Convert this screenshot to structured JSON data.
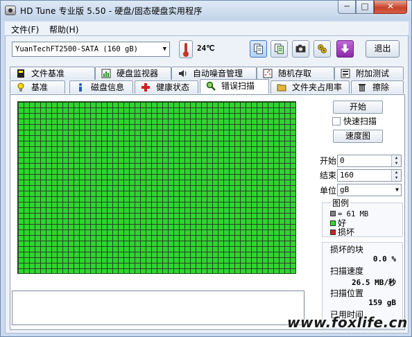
{
  "window": {
    "title": "HD Tune 专业版 5.50 - 硬盘/固态硬盘实用程序",
    "minimize": "─",
    "maximize": "□",
    "close": "✕"
  },
  "menu": {
    "file": "文件(F)",
    "help": "帮助(H)"
  },
  "toolbar": {
    "drive": "YuanTechFT2500-SATA (160 gB)",
    "drive_arrow": "▼",
    "temperature": "24℃",
    "exit_label": "退出",
    "icons": [
      "copy-icon",
      "copy-info-icon",
      "camera-icon",
      "settings-icon",
      "download-icon"
    ]
  },
  "tabs_top": [
    {
      "label": "文件基准",
      "icon": "benchmark-icon"
    },
    {
      "label": "硬盘监视器",
      "icon": "monitor-icon"
    },
    {
      "label": "自动噪音管理",
      "icon": "speaker-icon"
    },
    {
      "label": "随机存取",
      "icon": "random-access-icon"
    },
    {
      "label": "附加测试",
      "icon": "extra-tests-icon"
    }
  ],
  "tabs_bottom": [
    {
      "label": "基准",
      "icon": "bulb-icon"
    },
    {
      "label": "磁盘信息",
      "icon": "info-icon"
    },
    {
      "label": "健康状态",
      "icon": "health-icon"
    },
    {
      "label": "错误扫描",
      "icon": "magnifier-icon",
      "selected": true
    },
    {
      "label": "文件夹占用率",
      "icon": "folder-icon"
    },
    {
      "label": "擦除",
      "icon": "trash-icon"
    }
  ],
  "scan": {
    "start_button": "开始",
    "quick_scan_label": "快速扫描",
    "quick_scan_checked": false,
    "map_button": "速度图",
    "start_label": "开始",
    "start_value": "0",
    "end_label": "结束",
    "end_value": "160",
    "unit_label": "单位",
    "unit_value": "gB",
    "unit_arrow": "▼"
  },
  "legend": {
    "title": "图例",
    "block_size": "= 61 MB",
    "good": "好",
    "damaged": "损坏",
    "colors": {
      "block": "#808080",
      "good": "#2ed62e",
      "damaged": "#cc2222"
    }
  },
  "stats": {
    "damaged_blocks_label": "损坏的块",
    "damaged_blocks_value": "0.0 %",
    "scan_speed_label": "扫描速度",
    "scan_speed_value": "26.5 MB/秒",
    "scan_position_label": "扫描位置",
    "scan_position_value": "159 gB",
    "elapsed_label": "已用时间"
  },
  "grid": {
    "status": "good",
    "color": "#2ed62e"
  },
  "watermark": "www.foxlife.cn"
}
